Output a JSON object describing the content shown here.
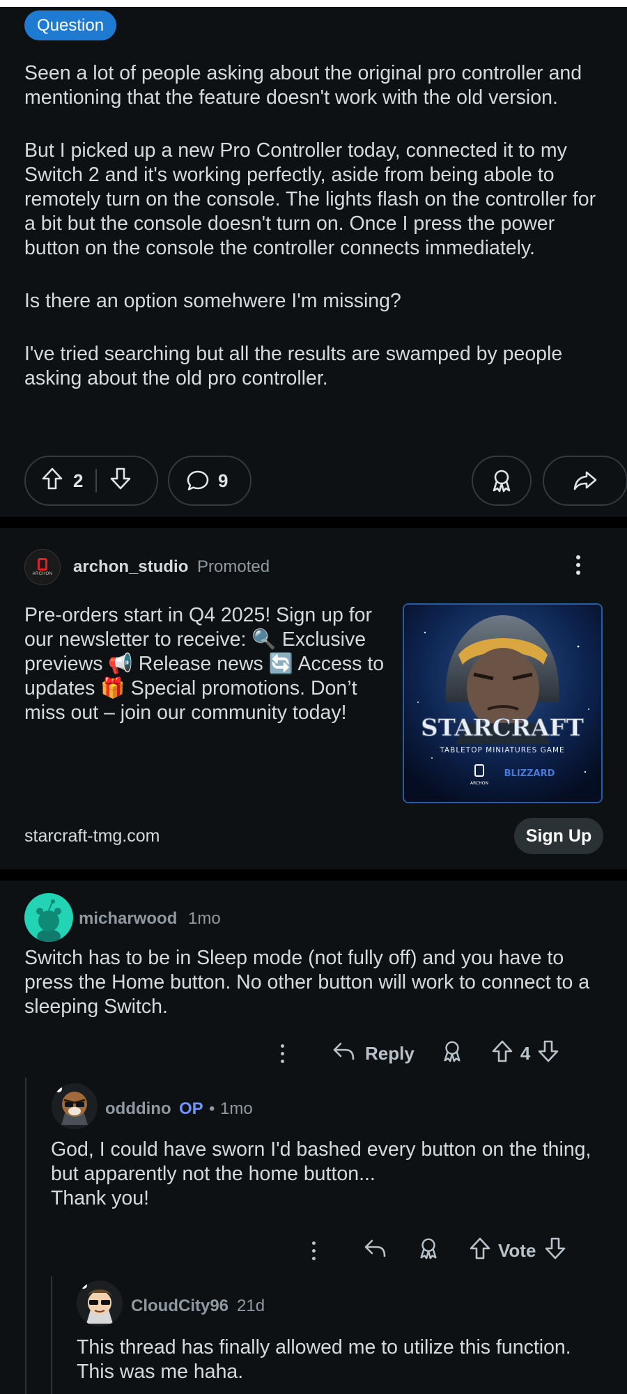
{
  "post": {
    "flair": "Question",
    "paragraphs": [
      "Seen a lot of people asking about the original pro controller and mentioning that the feature doesn't work with the old version.",
      "But I picked up a new Pro Controller today, connected it to my Switch 2 and it's working perfectly, aside from being abole to remotely turn on the console. The lights flash on the controller for a bit but the console doesn't turn on. Once I press the power button on the console the controller connects immediately.",
      "Is there an option somehwere I'm missing?",
      "I've tried searching but all the results are swamped by people asking about the old pro controller."
    ],
    "votes": "2",
    "comments": "9"
  },
  "ad": {
    "username": "archon_studio",
    "promoted_label": "Promoted",
    "avatar_text": "ARCHON",
    "body": "Pre-orders start in Q4 2025! Sign up for our newsletter to receive: 🔍 Exclusive previews 📢 Release news 🔄 Access to updates 🎁 Special promotions. Don’t miss out – join our community today!",
    "image": {
      "title": "STARCRAFT",
      "subtitle": "TABLETOP MINIATURES GAME",
      "logo_left": "ARCHON",
      "logo_right": "BLIZZARD"
    },
    "domain": "starcraft-tmg.com",
    "cta": "Sign Up"
  },
  "comments": [
    {
      "username": "micharwood",
      "time": "1mo",
      "body": "Switch has to be in Sleep mode (not fully off) and you have to press the Home button. No other button will work to connect to a sleeping Switch.",
      "reply_label": "Reply",
      "votes": "4"
    },
    {
      "username": "odddino",
      "op_badge": "OP",
      "separator": "•",
      "time": "1mo",
      "body": "God, I could have sworn I'd bashed every button on the thing, but apparently not the home button...\nThank you!",
      "vote_label": "Vote"
    },
    {
      "username": "CloudCity96",
      "time": "21d",
      "body": "This thread has finally allowed me to utilize this function. This was me haha."
    }
  ],
  "colors": {
    "background": "#0e1113",
    "flair": "#1f7ad2",
    "op": "#7193ff",
    "muted": "#8f999f"
  }
}
